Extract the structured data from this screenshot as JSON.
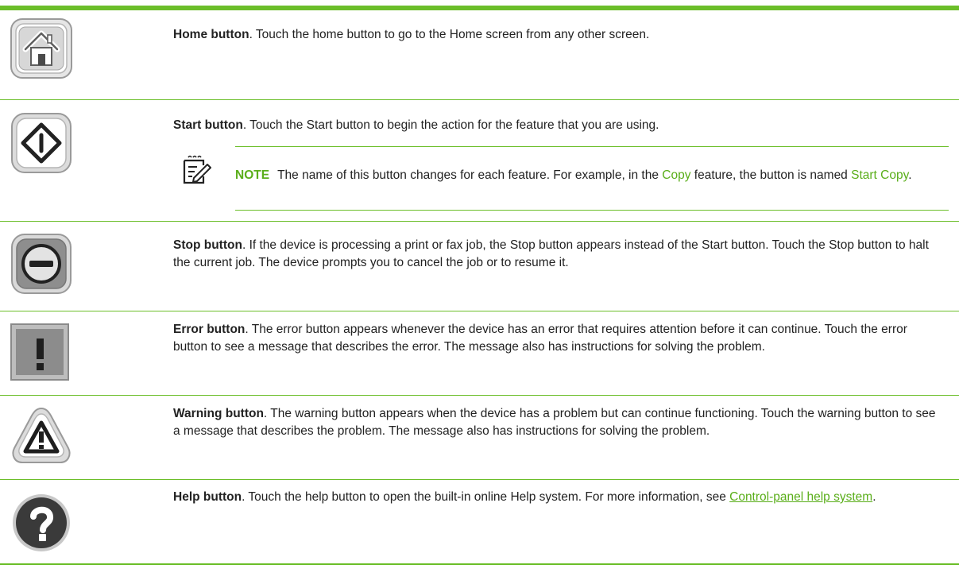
{
  "rows": [
    {
      "key": "home",
      "title": "Home button",
      "text": ". Touch the home button to go to the Home screen from any other screen.",
      "icon": "home-icon"
    },
    {
      "key": "start",
      "title": "Start button",
      "text": ". Touch the Start button to begin the action for the feature that you are using.",
      "icon": "start-icon",
      "note": {
        "label": "NOTE",
        "text_a": "The name of this button changes for each feature. For example, in the ",
        "copy_term": "Copy",
        "text_b": " feature, the button is named ",
        "start_copy_term": "Start Copy",
        "text_c": "."
      }
    },
    {
      "key": "stop",
      "title": "Stop button",
      "text": ". If the device is processing a print or fax job, the Stop button appears instead of the Start button. Touch the Stop button to halt the current job. The device prompts you to cancel the job or to resume it.",
      "icon": "stop-icon"
    },
    {
      "key": "error",
      "title": "Error button",
      "text": ". The error button appears whenever the device has an error that requires attention before it can continue. Touch the error button to see a message that describes the error. The message also has instructions for solving the problem.",
      "icon": "error-icon"
    },
    {
      "key": "warning",
      "title": "Warning button",
      "text": ". The warning button appears when the device has a problem but can continue functioning. Touch the warning button to see a message that describes the problem. The message also has instructions for solving the problem.",
      "icon": "warning-icon"
    },
    {
      "key": "help",
      "title": "Help button",
      "text": ". Touch the help button to open the built-in online Help system. For more information, see ",
      "link": "Control-panel help system",
      "text_end": ".",
      "icon": "help-icon"
    }
  ],
  "colors": {
    "accent": "#6bbe29",
    "link": "#5aae1a",
    "text": "#222222",
    "icon_gray": "#8c8c8c",
    "icon_dark": "#3a3a3a"
  }
}
